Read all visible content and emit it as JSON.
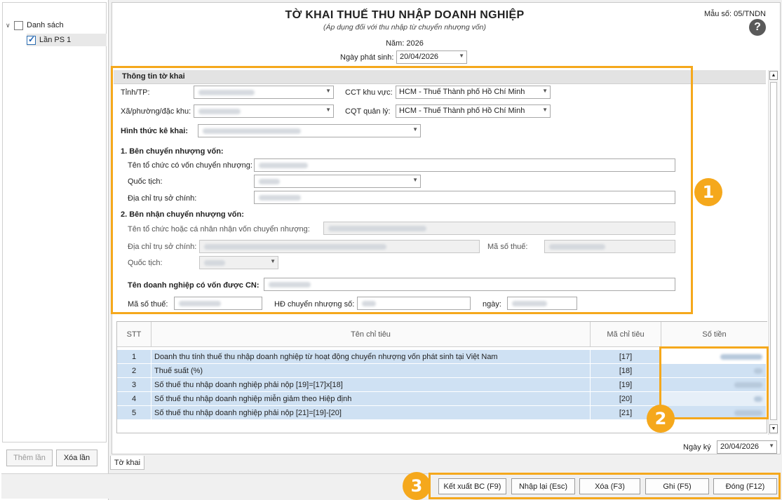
{
  "left": {
    "tree": [
      {
        "label": "Danh sách",
        "checked": false
      },
      {
        "label": "Lần PS 1",
        "checked": true
      }
    ],
    "add_button": "Thêm lần",
    "delete_button": "Xóa lần"
  },
  "header": {
    "title": "TỜ KHAI THUẾ THU NHẬP DOANH NGHIỆP",
    "subtitle": "(Áp dụng đối với thu nhập từ chuyển nhượng vốn)",
    "form_code": "Mẫu số: 05/TNDN",
    "help_icon": "?",
    "year": "Năm: 2026",
    "date_label": "Ngày phát sinh:",
    "date_value": "20/04/2026"
  },
  "info": {
    "section_title": "Thông tin tờ khai",
    "province_label": "Tỉnh/TP:",
    "ward_label": "Xã/phường/đặc khu:",
    "cct_label": "CCT khu vực:",
    "cct_value": "HCM - Thuế Thành phố Hồ Chí Minh",
    "cqt_label": "CQT quản lý:",
    "cqt_value": "HCM - Thuế Thành phố Hồ Chí Minh",
    "form_type_label": "Hình thức kê khai:",
    "transferor_heading": "1. Bên chuyển nhượng vốn:",
    "transferor_name_label": "Tên tổ chức có vốn chuyển nhượng:",
    "transferor_nationality_label": "Quốc tịch:",
    "transferor_address_label": "Địa chỉ trụ sở chính:",
    "transferee_heading": "2. Bên nhận chuyển nhượng vốn:",
    "transferee_name_label": "Tên tổ chức hoặc cá nhân nhận vốn chuyển nhượng:",
    "transferee_address_label": "Địa chỉ trụ sở chính:",
    "transferee_tax_label": "Mã số thuế:",
    "transferee_nationality_label": "Quốc tịch:",
    "company_label": "Tên doanh nghiệp có vốn được CN:",
    "company_tax_label": "Mã số thuế:",
    "contract_label": "HĐ chuyển nhượng số:",
    "contract_date_label": "ngày:"
  },
  "table": {
    "headers": [
      "STT",
      "Tên chỉ tiêu",
      "Mã chỉ tiêu",
      "Số tiền"
    ],
    "rows": [
      {
        "stt": "1",
        "name": "Doanh thu tính thuế thu nhập doanh nghiệp từ hoạt động chuyển nhượng vốn phát sinh tại Việt Nam",
        "code": "[17]"
      },
      {
        "stt": "2",
        "name": "Thuế suất (%)",
        "code": "[18]"
      },
      {
        "stt": "3",
        "name": "Số thuế thu nhập doanh nghiệp phải nộp [19]=[17]x[18]",
        "code": "[19]"
      },
      {
        "stt": "4",
        "name": "Số thuế thu nhập doanh nghiệp miễn giảm theo Hiệp định",
        "code": "[20]"
      },
      {
        "stt": "5",
        "name": "Số thuế thu nhập doanh nghiệp phải nộp [21]=[19]-[20]",
        "code": "[21]"
      }
    ]
  },
  "sign_date_label": "Ngày ký",
  "sign_date_value": "20/04/2026",
  "tab_label": "Tờ khai",
  "badges": [
    "1",
    "2",
    "3"
  ],
  "actions": {
    "export": "Kết xuất BC (F9)",
    "reset": "Nhập lại (Esc)",
    "delete": "Xóa (F3)",
    "save": "Ghi (F5)",
    "close": "Đóng (F12)"
  },
  "colors": {
    "accent": "#f5a81c",
    "row_highlight": "#cfe1f3"
  }
}
